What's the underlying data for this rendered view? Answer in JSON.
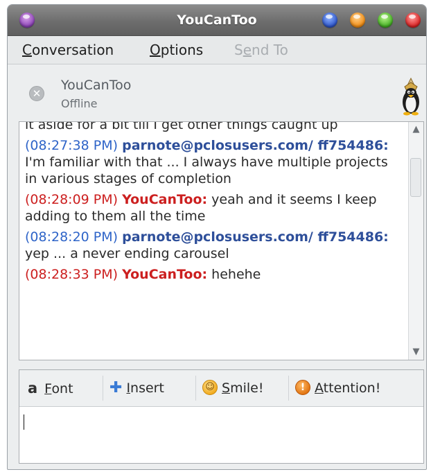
{
  "window": {
    "title": "YouCanToo"
  },
  "menubar": {
    "items": [
      {
        "label": "Conversation",
        "underline": "C",
        "rest": "onversation",
        "enabled": true
      },
      {
        "label": "Options",
        "underline": "O",
        "rest": "ptions",
        "enabled": true
      },
      {
        "label": "Send To",
        "prefix": "S",
        "underline": "e",
        "rest": "nd To",
        "enabled": false
      }
    ]
  },
  "contact": {
    "name": "YouCanToo",
    "status": "Offline",
    "status_icon": "offline-icon",
    "buddy_icon": "tux-penguin-icon"
  },
  "conversation": {
    "partial_line": "it aside for a bit till I get other things caught up",
    "messages": [
      {
        "timestamp": "(08:27:38 PM)",
        "sender": "parnote@pclosusers.com/ ff754486:",
        "text": " I'm familiar with that ... I always have multiple projects in various stages of completion",
        "color": "#2e64c8"
      },
      {
        "timestamp": "(08:28:09 PM)",
        "sender": "YouCanToo:",
        "text": " yeah and it seems I keep adding to them all the time",
        "color": "#cc1f1f"
      },
      {
        "timestamp": "(08:28:20 PM)",
        "sender": "parnote@pclosusers.com/ ff754486:",
        "text": " yep ... a never ending carousel",
        "color": "#2e64c8"
      },
      {
        "timestamp": "(08:28:33 PM)",
        "sender": "YouCanToo:",
        "text": " hehehe",
        "color": "#cc1f1f"
      }
    ]
  },
  "toolbar": {
    "font": {
      "icon": "font-a-icon",
      "glyph": "a",
      "underline": "F",
      "rest": "ont"
    },
    "insert": {
      "icon": "insert-plus-icon",
      "glyph": "✚",
      "underline": "I",
      "rest": "nsert"
    },
    "smile": {
      "icon": "smiley-icon",
      "glyph": "☺",
      "underline": "S",
      "rest": "mile!"
    },
    "attention": {
      "icon": "attention-icon",
      "glyph": "!",
      "underline": "A",
      "rest": "ttention!"
    }
  },
  "entry": {
    "value": ""
  },
  "colors": {
    "titlebar": "#6d6d6d",
    "local_user": "#2e64c8",
    "remote_user": "#cc1f1f"
  }
}
